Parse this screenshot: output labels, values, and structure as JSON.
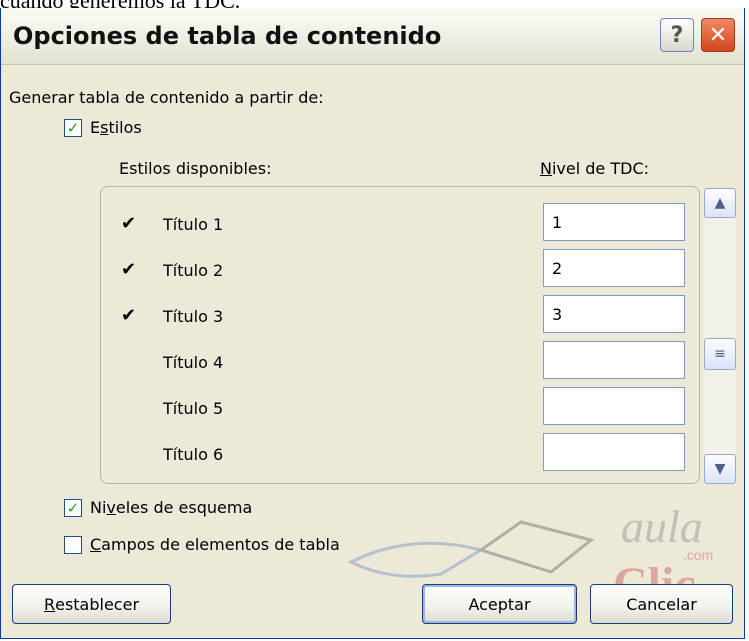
{
  "background_text": "cuando generemos la TDC.",
  "dialog": {
    "title": "Opciones de tabla de contenido",
    "help_glyph": "?",
    "close_glyph": "✕"
  },
  "generate_label": "Generar tabla de contenido a partir de:",
  "estilos": {
    "checked": true,
    "label_first": "E",
    "label_underline": "s",
    "label_rest": "tilos"
  },
  "available_styles_header": "Estilos disponibles:",
  "level_header_underline": "N",
  "level_header_rest": "ivel de TDC:",
  "styles": [
    {
      "mark": "✔",
      "name": "Título 1",
      "level": "1"
    },
    {
      "mark": "✔",
      "name": "Título 2",
      "level": "2"
    },
    {
      "mark": "✔",
      "name": "Título 3",
      "level": "3"
    },
    {
      "mark": "",
      "name": "Título 4",
      "level": ""
    },
    {
      "mark": "",
      "name": "Título 5",
      "level": ""
    },
    {
      "mark": "",
      "name": "Título 6",
      "level": ""
    }
  ],
  "outline_levels": {
    "checked": true,
    "label_first": "Ni",
    "label_underline": "v",
    "label_rest": "eles de esquema"
  },
  "table_fields": {
    "checked": false,
    "label_underline": "C",
    "label_rest": "ampos de elementos de tabla"
  },
  "buttons": {
    "reset_underline": "R",
    "reset_rest": "establecer",
    "accept": "Aceptar",
    "cancel": "Cancelar"
  },
  "watermark": {
    "line1": "aula",
    "line2": ".com",
    "line3": "Clic"
  },
  "colors": {
    "check_green": "#21a121",
    "title_bar": "#eeeee4",
    "dialog_bg": "#ece9d8",
    "close_red": "#d2461b"
  }
}
